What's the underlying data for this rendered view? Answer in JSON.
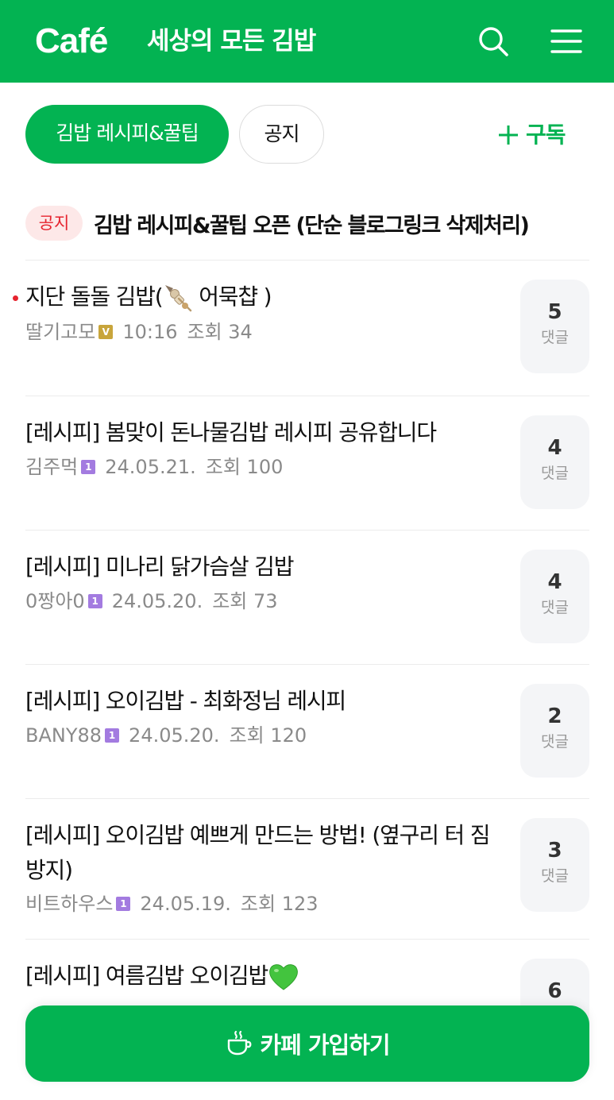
{
  "header": {
    "logo": "Café",
    "cafe_name": "세상의 모든 김밥",
    "search_icon": "search-icon",
    "menu_icon": "hamburger-menu-icon"
  },
  "tabs": [
    {
      "label": "김밥 레시피&꿀팁",
      "active": true
    },
    {
      "label": "공지",
      "active": false
    }
  ],
  "subscribe": {
    "icon": "plus-icon",
    "label": "구독"
  },
  "notice": {
    "badge": "공지",
    "title": "김밥 레시피&꿀팁 오픈 (단순 블로그링크 삭제처리)"
  },
  "posts": [
    {
      "title_pre": "지단 돌돌 김밥(",
      "title_emoji": "oden-skewer-emoji",
      "title_post": " 어묵챱 )",
      "author": "딸기고모",
      "level_badge": "V",
      "date": "10:16",
      "views": "조회 34",
      "comments": "5",
      "comment_label": "댓글",
      "is_new": true
    },
    {
      "title": "[레시피] 봄맞이 돈나물김밥 레시피 공유합니다",
      "author": "김주먹",
      "level_badge": "1",
      "date": "24.05.21.",
      "views": "조회 100",
      "comments": "4",
      "comment_label": "댓글"
    },
    {
      "title": "[레시피] 미나리 닭가슴살 김밥",
      "author": "0짱아0",
      "level_badge": "1",
      "date": "24.05.20.",
      "views": "조회 73",
      "comments": "4",
      "comment_label": "댓글"
    },
    {
      "title": "[레시피] 오이김밥 - 최화정님 레시피",
      "author": "BANY88",
      "level_badge": "1",
      "date": "24.05.20.",
      "views": "조회 120",
      "comments": "2",
      "comment_label": "댓글"
    },
    {
      "title": "[레시피] 오이김밥 예쁘게 만드는 방법! (옆구리 터 짐 방지)",
      "author": "비트하우스",
      "level_badge": "1",
      "date": "24.05.19.",
      "views": "조회 123",
      "comments": "3",
      "comment_label": "댓글"
    },
    {
      "title_pre": "[레시피] 여름김밥 오이김밥",
      "title_emoji": "green-heart-emoji",
      "comments": "6"
    }
  ],
  "join_button": {
    "icon": "coffee-cup-icon",
    "label": "카페 가입하기"
  },
  "colors": {
    "brand": "#03b352",
    "notice_red": "#e6232e",
    "level_v": "#c8a53b",
    "level_1": "#a37be0"
  }
}
